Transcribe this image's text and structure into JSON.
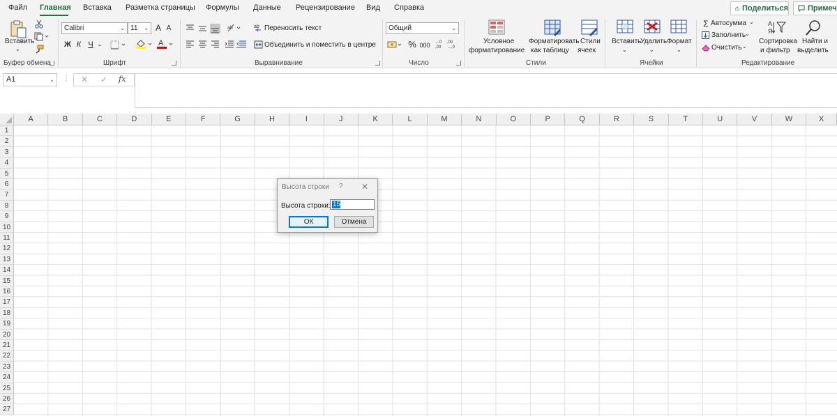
{
  "tabs": [
    {
      "label": "Файл"
    },
    {
      "label": "Главная"
    },
    {
      "label": "Вставка"
    },
    {
      "label": "Разметка страницы"
    },
    {
      "label": "Формулы"
    },
    {
      "label": "Данные"
    },
    {
      "label": "Рецензирование"
    },
    {
      "label": "Вид"
    },
    {
      "label": "Справка"
    }
  ],
  "share_label": "Поделиться",
  "notes_label": "Примеча",
  "ribbon": {
    "clipboard": {
      "paste_label": "Вставить",
      "group": "Буфер обмена"
    },
    "font": {
      "name": "Calibri",
      "size": "11",
      "bold": "Ж",
      "italic": "К",
      "underline": "Ч",
      "grow": "A",
      "shrink": "A",
      "color_letter": "A",
      "group": "Шрифт"
    },
    "alignment": {
      "wrap_label": "Переносить текст",
      "merge_label": "Объединить и поместить в центре",
      "group": "Выравнивание"
    },
    "number": {
      "format": "Общий",
      "percent": "%",
      "thousands": "000",
      "group": "Число"
    },
    "styles": {
      "cond_line1": "Условное",
      "cond_line2": "форматирование",
      "table_line1": "Форматировать",
      "table_line2": "как таблицу",
      "cell_line1": "Стили",
      "cell_line2": "ячеек",
      "group": "Стили"
    },
    "cells": {
      "insert": "Вставить",
      "delete": "Удалить",
      "format": "Формат",
      "group": "Ячейки"
    },
    "editing": {
      "autosum": "Автосумма",
      "fill": "Заполнить",
      "clear": "Очистить",
      "sort_line1": "Сортировка",
      "sort_line2": "и фильтр",
      "find_line1": "Найти и",
      "find_line2": "выделить",
      "group": "Редактирование"
    }
  },
  "formula_bar": {
    "name_box": "A1",
    "cancel": "✕",
    "enter": "✓",
    "fx": "fx"
  },
  "grid": {
    "columns": [
      "A",
      "B",
      "C",
      "D",
      "E",
      "F",
      "G",
      "H",
      "I",
      "J",
      "K",
      "L",
      "M",
      "N",
      "O",
      "P",
      "Q",
      "R",
      "S",
      "T",
      "U",
      "V",
      "W",
      "X"
    ],
    "rows": [
      "1",
      "2",
      "3",
      "4",
      "5",
      "6",
      "7",
      "8",
      "9",
      "10",
      "11",
      "12",
      "13",
      "14",
      "15",
      "16",
      "17",
      "18",
      "19",
      "20",
      "21",
      "22",
      "23",
      "24",
      "25",
      "26",
      "27"
    ]
  },
  "dialog": {
    "title": "Высота строки",
    "help": "?",
    "close": "✕",
    "label": "Высота строки:",
    "value": "15",
    "ok": "ОК",
    "cancel": "Отмена"
  },
  "colors": {
    "accent": "#217346",
    "ribbon_bg": "#f3f3f3",
    "grid_line": "#e1e1e1",
    "focus": "#0078d7"
  },
  "icons": [
    "share-icon",
    "comment-icon",
    "paste-icon",
    "cut-icon",
    "copy-icon",
    "format-painter-icon",
    "borders-icon",
    "fill-color-icon",
    "font-color-icon",
    "align-icon",
    "orientation-icon",
    "wrap-text-icon",
    "merge-icon",
    "currency-icon",
    "decimal-icon",
    "conditional-format-icon",
    "format-table-icon",
    "cell-styles-icon",
    "insert-cells-icon",
    "delete-cells-icon",
    "format-cells-icon",
    "autosum-icon",
    "fill-icon",
    "eraser-icon",
    "sort-filter-icon",
    "find-icon"
  ]
}
